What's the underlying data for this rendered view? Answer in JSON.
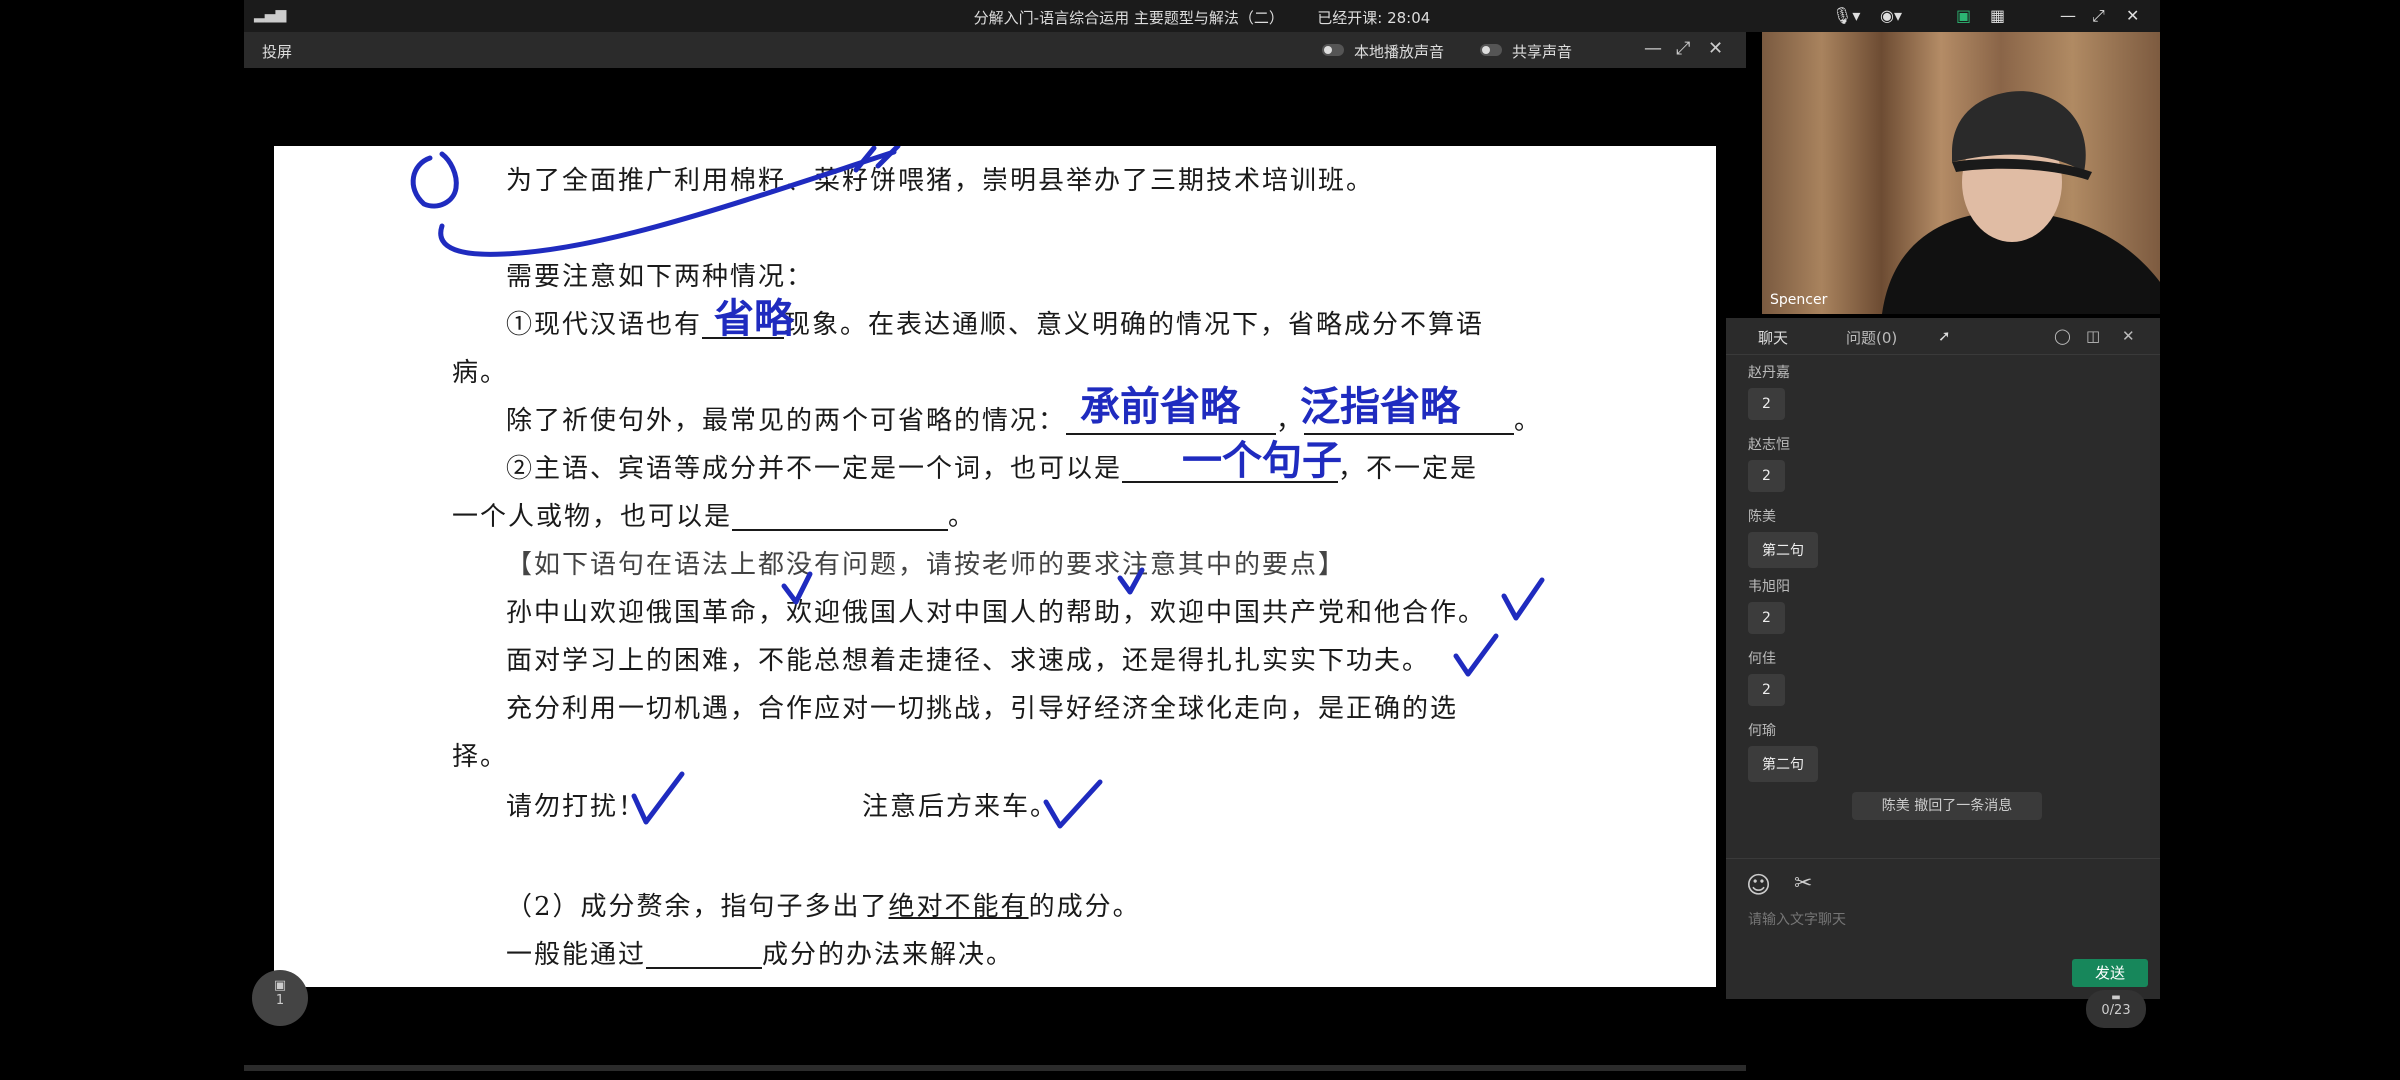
{
  "app_bar": {
    "title": "分解入门-语言综合运用 主要题型与解法（二）",
    "elapsed": "已经开课: 28:04"
  },
  "share_window": {
    "label": "投屏",
    "local_audio": "本地播放声音",
    "share_audio": "共享声音"
  },
  "document": {
    "line1": "为了全面推广利用棉籽、菜籽饼喂猪，崇明县举办了三期技术培训班。",
    "line2": "需要注意如下两种情况：",
    "line3a": "①现代汉语也有",
    "line3b": "现象。在表达通顺、意义明确的情况下，省略成分不算语",
    "line4": "病。",
    "line5a": "除了祈使句外，最常见的两个可省略的情况：",
    "line5b": "，",
    "line5c": "。",
    "line6a": "②主语、宾语等成分并不一定是一个词，也可以是",
    "line6b": "，不一定是",
    "line7a": "一个人或物，也可以是",
    "line7b": "。",
    "line8": "【如下语句在语法上都没有问题，请按老师的要求注意其中的要点】",
    "line9": "孙中山欢迎俄国革命，欢迎俄国人对中国人的帮助，欢迎中国共产党和他合作。",
    "line10": "面对学习上的困难，不能总想着走捷径、求速成，还是得扎扎实实下功夫。",
    "line11": "充分利用一切机遇，合作应对一切挑战，引导好经济全球化走向，是正确的选",
    "line12": "择。",
    "line13a": "请勿打扰！",
    "line13b": "注意后方来车。",
    "line14a": "（2）成分赘余，指句子多出了",
    "line14b": "绝对不能有",
    "line14c": "的成分。",
    "line15a": "一般能通过",
    "line15b": "成分的办法来解决。"
  },
  "handwriting": {
    "shenglue": "省略",
    "chengqian": "承前省略",
    "fanzhi": "泛指省略",
    "yigejuzi": "一个句子"
  },
  "slide_badge": {
    "count": "1"
  },
  "camera": {
    "name": "Spencer"
  },
  "chat": {
    "tab_chat": "聊天",
    "tab_questions": "问题(0)",
    "messages": [
      {
        "name": "赵丹嘉",
        "text": "2"
      },
      {
        "name": "赵志恒",
        "text": "2"
      },
      {
        "name": "陈美",
        "text": "第二句"
      },
      {
        "name": "韦旭阳",
        "text": "2"
      },
      {
        "name": "何佳",
        "text": "2"
      },
      {
        "name": "何瑜",
        "text": "第二句"
      }
    ],
    "recall_notice": "陈美 撤回了一条消息",
    "input_placeholder": "请输入文字聊天",
    "send_label": "发送"
  },
  "pager": {
    "text": "0/23"
  }
}
